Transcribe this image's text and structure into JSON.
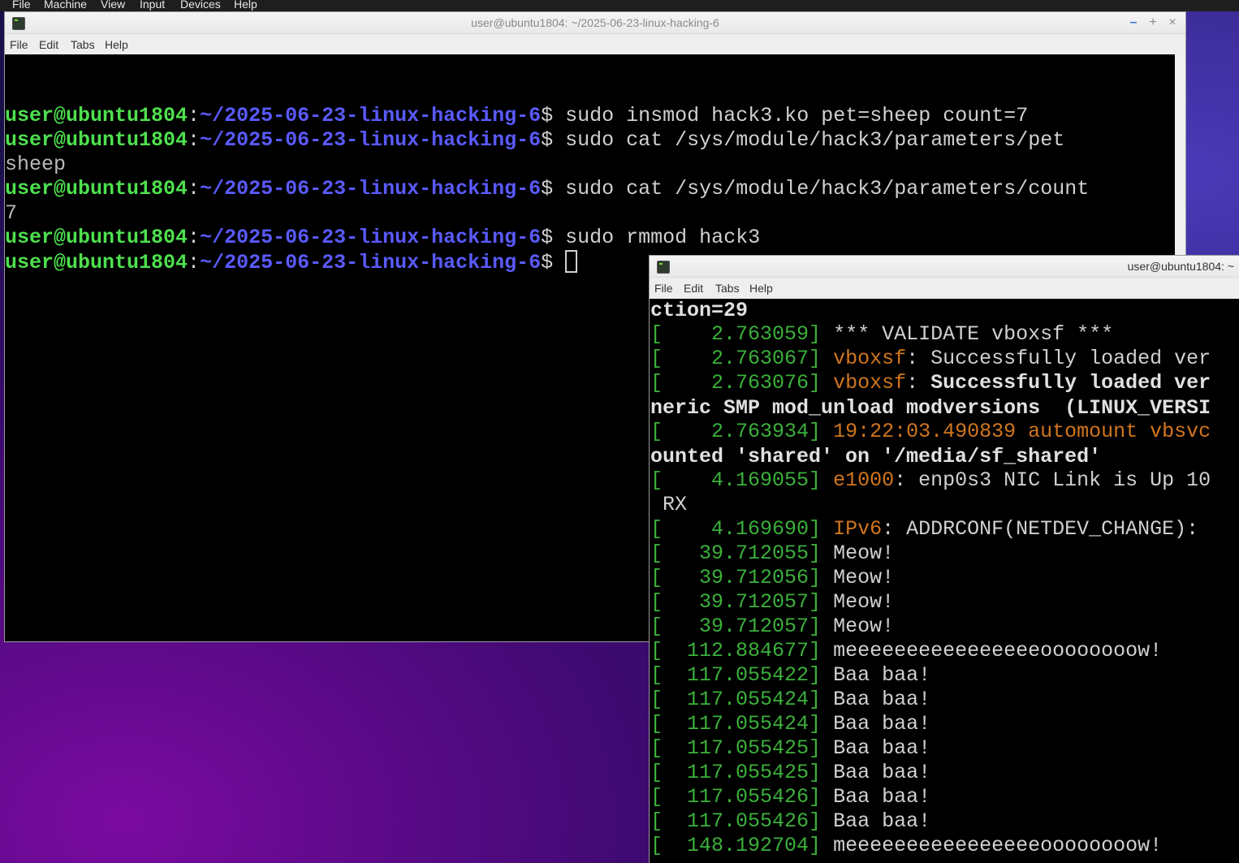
{
  "vm_menu": [
    "File",
    "Machine",
    "View",
    "Input",
    "Devices",
    "Help"
  ],
  "win1": {
    "title": "user@ubuntu1804: ~/2025-06-23-linux-hacking-6",
    "controls": [
      "–",
      "+",
      "×"
    ],
    "menu": [
      "File",
      "Edit",
      "Tabs",
      "Help"
    ],
    "prompt_user": "user@ubuntu1804",
    "prompt_path": "~/2025-06-23-linux-hacking-6",
    "prompt_sym": "$ ",
    "commands": [
      "sudo insmod hack3.ko pet=sheep count=7",
      "sudo cat /sys/module/hack3/parameters/pet",
      "sudo cat /sys/module/hack3/parameters/count",
      "sudo rmmod hack3"
    ],
    "outputs": [
      "sheep",
      "7"
    ]
  },
  "win2": {
    "title": "user@ubuntu1804: ~",
    "menu": [
      "File",
      "Edit",
      "Tabs",
      "Help"
    ],
    "lines": {
      "l0": "ction=29",
      "l1_ts": "    2.763059",
      "l1_msg": "*** VALIDATE vboxsf ***",
      "l2_ts": "    2.763067",
      "l2_src": "vboxsf",
      "l2_msg": "Successfully loaded ver",
      "l3_ts": "    2.763076",
      "l3_src": "vboxsf",
      "l3_msg": "Successfully loaded ver",
      "l4": "neric SMP mod_unload modversions  (LINUX_VERSI",
      "l5_ts": "    2.763934",
      "l5_msg": "19:22:03.490839 automount vbsvc",
      "l6": "ounted 'shared' on '/media/sf_shared'",
      "l7_ts": "    4.169055",
      "l7_src": "e1000",
      "l7_msg": "enp0s3 NIC Link is Up 10",
      "l8": " RX",
      "l9_ts": "    4.169690",
      "l9_src": "IPv6",
      "l9_msg": "ADDRCONF(NETDEV_CHANGE):",
      "meow": [
        {
          "ts": "   39.712055",
          "msg": "Meow!"
        },
        {
          "ts": "   39.712056",
          "msg": "Meow!"
        },
        {
          "ts": "   39.712057",
          "msg": "Meow!"
        },
        {
          "ts": "   39.712057",
          "msg": "Meow!"
        }
      ],
      "meow_long_1_ts": "  112.884677",
      "meow_long_1_msg": "meeeeeeeeeeeeeeeeoooooooow!",
      "baa": [
        {
          "ts": "  117.055422",
          "msg": "Baa baa!"
        },
        {
          "ts": "  117.055424",
          "msg": "Baa baa!"
        },
        {
          "ts": "  117.055424",
          "msg": "Baa baa!"
        },
        {
          "ts": "  117.055425",
          "msg": "Baa baa!"
        },
        {
          "ts": "  117.055425",
          "msg": "Baa baa!"
        },
        {
          "ts": "  117.055426",
          "msg": "Baa baa!"
        },
        {
          "ts": "  117.055426",
          "msg": "Baa baa!"
        }
      ],
      "meow_long_2_ts": "  148.192704",
      "meow_long_2_msg": "meeeeeeeeeeeeeeeeoooooooow!"
    }
  },
  "colors": {
    "prompt_user": "#4ee04e",
    "prompt_path": "#5a5aff",
    "kernel_ts": "#3bb03b",
    "kernel_src": "#d0761e"
  }
}
